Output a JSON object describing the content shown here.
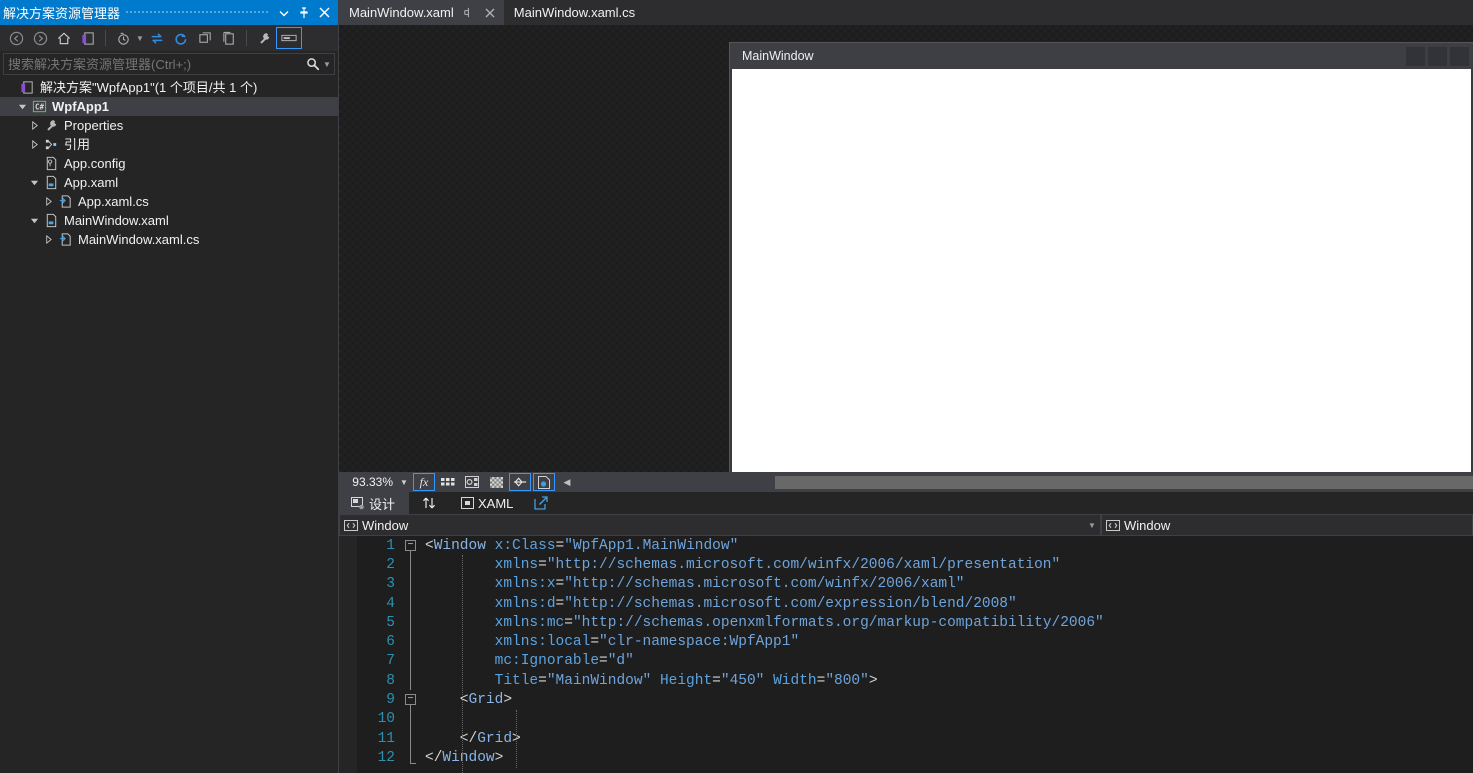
{
  "solution_explorer": {
    "title": "解决方案资源管理器",
    "title_buttons": [
      {
        "name": "dropdown-icon",
        "glyph": "▼"
      },
      {
        "name": "pin-icon",
        "glyph": "pin"
      },
      {
        "name": "close-icon",
        "glyph": "✕"
      }
    ],
    "toolbar": [
      {
        "name": "back-button",
        "icon": "back-arrow-circle-icon"
      },
      {
        "name": "forward-button",
        "icon": "forward-arrow-circle-icon"
      },
      {
        "name": "home-button",
        "icon": "home-icon"
      },
      {
        "name": "solution-button",
        "icon": "solution-icon"
      },
      {
        "name": "pending-changes-button",
        "icon": "clock-icon"
      },
      {
        "name": "sync-button",
        "icon": "sync-icon"
      },
      {
        "name": "refresh-button",
        "icon": "refresh-icon"
      },
      {
        "name": "collapse-all-button",
        "icon": "collapse-all-icon"
      },
      {
        "name": "show-all-files-button",
        "icon": "show-all-files-icon"
      },
      {
        "name": "properties-button",
        "icon": "wrench-icon"
      },
      {
        "name": "preview-selected-items-button",
        "icon": "preview-icon"
      }
    ],
    "search": {
      "placeholder": "搜索解决方案资源管理器(Ctrl+;)",
      "value": ""
    },
    "tree": [
      {
        "label": "解决方案\"WpfApp1\"(1 个项目/共 1 个)",
        "icon": "solution-icon",
        "indent": 0,
        "expander": "none",
        "bold": false,
        "selected": false
      },
      {
        "label": "WpfApp1",
        "icon": "csharp-project-icon",
        "indent": 1,
        "expander": "expanded",
        "bold": true,
        "selected": true
      },
      {
        "label": "Properties",
        "icon": "wrench-icon",
        "indent": 2,
        "expander": "collapsed",
        "bold": false,
        "selected": false
      },
      {
        "label": "引用",
        "icon": "references-icon",
        "indent": 2,
        "expander": "collapsed",
        "bold": false,
        "selected": false
      },
      {
        "label": "App.config",
        "icon": "config-file-icon",
        "indent": 2,
        "expander": "none",
        "bold": false,
        "selected": false
      },
      {
        "label": "App.xaml",
        "icon": "xaml-file-icon",
        "indent": 2,
        "expander": "expanded",
        "bold": false,
        "selected": false
      },
      {
        "label": "App.xaml.cs",
        "icon": "csharp-file-icon",
        "indent": 3,
        "expander": "collapsed",
        "bold": false,
        "selected": false
      },
      {
        "label": "MainWindow.xaml",
        "icon": "xaml-file-icon",
        "indent": 2,
        "expander": "expanded",
        "bold": false,
        "selected": false
      },
      {
        "label": "MainWindow.xaml.cs",
        "icon": "csharp-file-icon",
        "indent": 3,
        "expander": "collapsed",
        "bold": false,
        "selected": false
      }
    ]
  },
  "tabs": [
    {
      "label": "MainWindow.xaml",
      "active": true,
      "pin": "pin-icon",
      "close": "✕"
    },
    {
      "label": "MainWindow.xaml.cs",
      "active": false
    }
  ],
  "designer": {
    "preview_window": {
      "title": "MainWindow",
      "buttons": [
        "minimize-button",
        "maximize-button",
        "close-button"
      ]
    },
    "toolbar": {
      "zoom": "93.33%",
      "zoom_caret": "▼",
      "buttons": [
        {
          "name": "effects-button",
          "glyph": "fx",
          "boxed": true
        },
        {
          "name": "grid-rails-button",
          "glyph": "grid",
          "boxed": false
        },
        {
          "name": "snapping-button",
          "glyph": "snap",
          "boxed": false
        },
        {
          "name": "transparency-grid-button",
          "glyph": "checker",
          "boxed": false
        },
        {
          "name": "snap-to-gridlines-button",
          "glyph": "snapline",
          "boxed": true
        },
        {
          "name": "disable-project-code-button",
          "glyph": "projectcode",
          "boxed": true
        }
      ],
      "collapse_arrow": "◀"
    },
    "split_tabs": [
      {
        "label": "设计",
        "icon": "design-view-icon",
        "active": true
      },
      {
        "label": "XAML",
        "icon": "xaml-view-icon",
        "active": false
      }
    ],
    "swap_panes_icon": "swap-panes-icon",
    "expand_pane_icon": "pop-out-icon"
  },
  "navbars": {
    "left": {
      "label": "Window",
      "icon": "window-element-icon",
      "caret": "▼"
    },
    "right": {
      "label": "Window",
      "icon": "window-element-icon"
    }
  },
  "editor": {
    "language": "XAML",
    "lines": [
      {
        "n": 1,
        "fold": "start",
        "indent": 0,
        "tokens": [
          {
            "t": "punct",
            "v": "<"
          },
          {
            "t": "tagname",
            "v": "Window"
          },
          {
            "t": "opeq",
            "v": " "
          },
          {
            "t": "attr",
            "v": "x:Class"
          },
          {
            "t": "opeq",
            "v": "="
          },
          {
            "t": "strval",
            "v": "\"WpfApp1.MainWindow\""
          }
        ]
      },
      {
        "n": 2,
        "fold": "bar",
        "indent": 1,
        "tokens": [
          {
            "t": "attr",
            "v": "        xmlns"
          },
          {
            "t": "opeq",
            "v": "="
          },
          {
            "t": "strval",
            "v": "\"http://schemas.microsoft.com/winfx/2006/xaml/presentation\""
          }
        ]
      },
      {
        "n": 3,
        "fold": "bar",
        "indent": 1,
        "tokens": [
          {
            "t": "attr",
            "v": "        xmlns:x"
          },
          {
            "t": "opeq",
            "v": "="
          },
          {
            "t": "strval",
            "v": "\"http://schemas.microsoft.com/winfx/2006/xaml\""
          }
        ]
      },
      {
        "n": 4,
        "fold": "bar",
        "indent": 1,
        "tokens": [
          {
            "t": "attr",
            "v": "        xmlns:d"
          },
          {
            "t": "opeq",
            "v": "="
          },
          {
            "t": "strval",
            "v": "\"http://schemas.microsoft.com/expression/blend/2008\""
          }
        ]
      },
      {
        "n": 5,
        "fold": "bar",
        "indent": 1,
        "tokens": [
          {
            "t": "attr",
            "v": "        xmlns:mc"
          },
          {
            "t": "opeq",
            "v": "="
          },
          {
            "t": "strval",
            "v": "\"http://schemas.openxmlformats.org/markup-compatibility/2006\""
          }
        ]
      },
      {
        "n": 6,
        "fold": "bar",
        "indent": 1,
        "tokens": [
          {
            "t": "attr",
            "v": "        xmlns:local"
          },
          {
            "t": "opeq",
            "v": "="
          },
          {
            "t": "strval",
            "v": "\"clr-namespace:WpfApp1\""
          }
        ]
      },
      {
        "n": 7,
        "fold": "bar",
        "indent": 1,
        "tokens": [
          {
            "t": "attr",
            "v": "        mc:Ignorable"
          },
          {
            "t": "opeq",
            "v": "="
          },
          {
            "t": "strval",
            "v": "\"d\""
          }
        ]
      },
      {
        "n": 8,
        "fold": "bar",
        "indent": 1,
        "tokens": [
          {
            "t": "attr",
            "v": "        Title"
          },
          {
            "t": "opeq",
            "v": "="
          },
          {
            "t": "strval",
            "v": "\"MainWindow\""
          },
          {
            "t": "opeq",
            "v": " "
          },
          {
            "t": "attr",
            "v": "Height"
          },
          {
            "t": "opeq",
            "v": "="
          },
          {
            "t": "strval",
            "v": "\"450\""
          },
          {
            "t": "opeq",
            "v": " "
          },
          {
            "t": "attr",
            "v": "Width"
          },
          {
            "t": "opeq",
            "v": "="
          },
          {
            "t": "strval",
            "v": "\"800\""
          },
          {
            "t": "punct",
            "v": ">"
          }
        ]
      },
      {
        "n": 9,
        "fold": "start2",
        "indent": 1,
        "tokens": [
          {
            "t": "punct",
            "v": "    <"
          },
          {
            "t": "tagname",
            "v": "Grid"
          },
          {
            "t": "punct",
            "v": ">"
          }
        ]
      },
      {
        "n": 10,
        "fold": "bar2",
        "indent": 2,
        "tokens": [
          {
            "t": "opeq",
            "v": "        "
          }
        ]
      },
      {
        "n": 11,
        "fold": "bar2",
        "indent": 2,
        "tokens": [
          {
            "t": "punct",
            "v": "    </"
          },
          {
            "t": "tagname",
            "v": "Grid"
          },
          {
            "t": "punct",
            "v": ">"
          }
        ]
      },
      {
        "n": 12,
        "fold": "end",
        "indent": 0,
        "tokens": [
          {
            "t": "punct",
            "v": "</"
          },
          {
            "t": "tagname",
            "v": "Window"
          },
          {
            "t": "punct",
            "v": ">"
          }
        ]
      }
    ]
  },
  "colors": {
    "accent_blue": "#007acc",
    "panel_bg": "#252526",
    "toolbar_bg": "#2d2d30",
    "editor_bg": "#1e1e1e",
    "tab_active_bg": "#3f3f46",
    "line_number": "#2b91af",
    "string": "#6ea4db",
    "attribute": "#5ba3e0",
    "tagname": "#8ab4e8",
    "highlight_border": "#3399ff",
    "preview_client": "#ffffff"
  }
}
